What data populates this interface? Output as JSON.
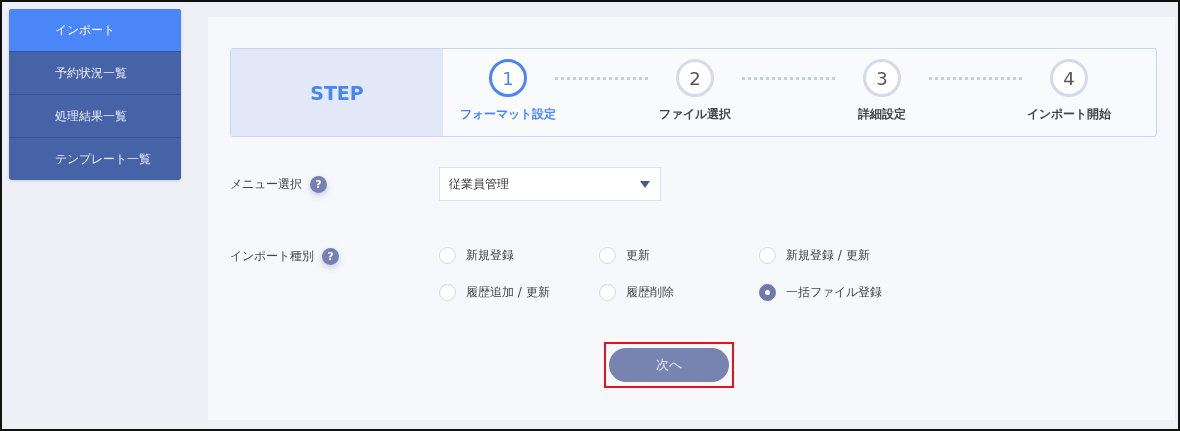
{
  "sidebar": {
    "items": [
      {
        "label": "インポート",
        "selected": true
      },
      {
        "label": "予約状況一覧",
        "selected": false
      },
      {
        "label": "処理結果一覧",
        "selected": false
      },
      {
        "label": "テンプレート一覧",
        "selected": false
      }
    ]
  },
  "steps": {
    "title": "STEP",
    "items": [
      {
        "number": "1",
        "label": "フォーマット設定",
        "selected": true
      },
      {
        "number": "2",
        "label": "ファイル選択",
        "selected": false
      },
      {
        "number": "3",
        "label": "詳細設定",
        "selected": false
      },
      {
        "number": "4",
        "label": "インポート開始",
        "selected": false
      }
    ]
  },
  "menu_select": {
    "label": "メニュー選択",
    "help": "?",
    "value": "従業員管理"
  },
  "import_type": {
    "label": "インポート種別",
    "help": "?",
    "options": [
      {
        "label": "新規登録",
        "selected": false
      },
      {
        "label": "更新",
        "selected": false
      },
      {
        "label": "新規登録 / 更新",
        "selected": false
      },
      {
        "label": "履歴追加 / 更新",
        "selected": false
      },
      {
        "label": "履歴削除",
        "selected": false
      },
      {
        "label": "一括ファイル登録",
        "selected": true
      }
    ]
  },
  "next_button": {
    "label": "次へ",
    "highlighted": true
  }
}
